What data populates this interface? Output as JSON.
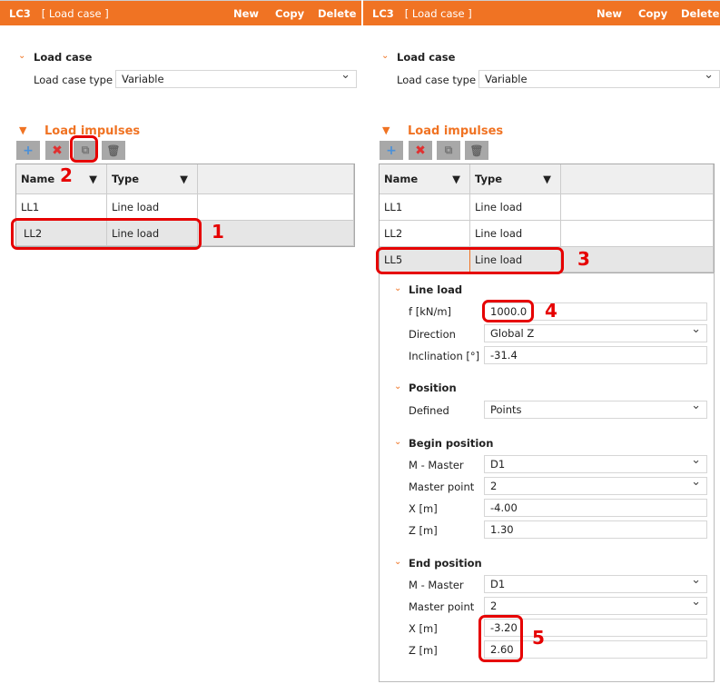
{
  "left": {
    "header": {
      "id": "LC3",
      "subtitle": "[ Load case ]",
      "new": "New",
      "copy": "Copy",
      "delete": "Delete"
    },
    "load_case": {
      "title": "Load case",
      "type_label": "Load case type",
      "type_value": "Variable"
    },
    "impulses": {
      "title": "Load impulses",
      "columns": [
        "Name",
        "Type"
      ],
      "rows": [
        {
          "name": "LL1",
          "type": "Line load"
        },
        {
          "name": "LL2",
          "type": "Line load"
        }
      ]
    }
  },
  "right": {
    "header": {
      "id": "LC3",
      "subtitle": "[ Load case ]",
      "new": "New",
      "copy": "Copy",
      "delete": "Delete"
    },
    "load_case": {
      "title": "Load case",
      "type_label": "Load case type",
      "type_value": "Variable"
    },
    "impulses": {
      "title": "Load impulses",
      "columns": [
        "Name",
        "Type"
      ],
      "rows": [
        {
          "name": "LL1",
          "type": "Line load"
        },
        {
          "name": "LL2",
          "type": "Line load"
        },
        {
          "name": "LL5",
          "type": "Line load"
        }
      ]
    },
    "line_load": {
      "title": "Line load",
      "f_label": "f [kN/m]",
      "f": "1000.0",
      "dir_label": "Direction",
      "dir": "Global Z",
      "incl_label": "Inclination [°]",
      "incl": "-31.4"
    },
    "position": {
      "title": "Position",
      "defined_label": "Defined",
      "defined": "Points"
    },
    "begin": {
      "title": "Begin position",
      "master_label": "M - Master",
      "master": "D1",
      "mp_label": "Master point",
      "mp": "2",
      "x_label": "X [m]",
      "x": "-4.00",
      "z_label": "Z [m]",
      "z": "1.30"
    },
    "end": {
      "title": "End position",
      "master_label": "M - Master",
      "master": "D1",
      "mp_label": "Master point",
      "mp": "2",
      "x_label": "X [m]",
      "x": "-3.20",
      "z_label": "Z [m]",
      "z": "2.60"
    }
  },
  "annotations": [
    "1",
    "2",
    "3",
    "4",
    "5"
  ],
  "colors": {
    "accent": "#f07323",
    "highlight": "#e60000"
  }
}
